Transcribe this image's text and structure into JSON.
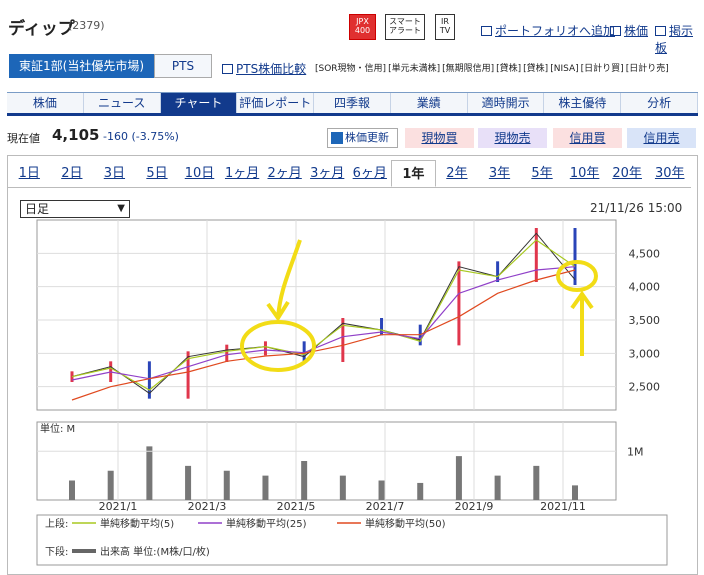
{
  "header": {
    "name": "ディップ",
    "code": "(2379)",
    "badges": {
      "jpx": "JPX 400",
      "alert": "スマート アラート",
      "ir": "IR TV"
    },
    "links": {
      "portfolio": "ポートフォリオへ追加",
      "stock_price": "株価",
      "board": "掲示板"
    }
  },
  "market_tabs": {
    "primary": "東証1部(当社優先市場)",
    "secondary": "PTS",
    "compare_link": "PTS株価比較"
  },
  "tags": [
    "[SOR現物・信用]",
    "[単元未満株]",
    "[無期限信用]",
    "[貸株]",
    "[貸株]",
    "[NISA]",
    "[日計り買]",
    "[日計り売]"
  ],
  "nav": [
    "株価",
    "ニュース",
    "チャート",
    "評価レポート",
    "四季報",
    "業績",
    "適時開示",
    "株主優待",
    "分析"
  ],
  "nav_active": "チャート",
  "price": {
    "label": "現在値",
    "value": "4,105",
    "change": "-160 (-3.75%)"
  },
  "buttons": {
    "refresh": "株価更新",
    "cash_buy": "現物買",
    "cash_sell": "現物売",
    "margin_buy": "信用買",
    "margin_sell": "信用売"
  },
  "colors": {
    "cash_buy": "#fbe0e0",
    "cash_sell": "#e8e0f8",
    "margin_buy": "#fbe0e0",
    "margin_sell": "#d9e4f8",
    "nav_active": "#123a8c",
    "up_candle": "#e0364c",
    "down_candle": "#2a44b8",
    "ma5": "#a8c820",
    "ma25": "#9040c8",
    "ma50": "#e04a20",
    "annotation": "#f2dc16"
  },
  "periods": [
    "1日",
    "2日",
    "3日",
    "5日",
    "10日",
    "1ヶ月",
    "2ヶ月",
    "3ヶ月",
    "6ヶ月",
    "1年",
    "2年",
    "3年",
    "5年",
    "10年",
    "20年",
    "30年"
  ],
  "period_active": "1年",
  "interval": "日足",
  "datetime": "21/11/26 15:00",
  "volume_unit": "単位: M",
  "legend": {
    "upper_label": "上段:",
    "lower_label": "下段:",
    "ma5": "単純移動平均(5)",
    "ma25": "単純移動平均(25)",
    "ma50": "単純移動平均(50)",
    "volume": "出来高 単位:(M株/口/枚)"
  },
  "chart_data": {
    "type": "line",
    "title": "",
    "xlabel": "",
    "ylabel": "",
    "x_ticks": [
      "2021/1",
      "2021/3",
      "2021/5",
      "2021/7",
      "2021/9",
      "2021/11"
    ],
    "y_ticks": [
      2500,
      3000,
      3500,
      4000,
      4500
    ],
    "ylim": [
      2150,
      5000
    ],
    "volume_ticks": [
      "1M"
    ],
    "volume_ylim": [
      0,
      1.6
    ],
    "grid": true,
    "series": [
      {
        "name": "",
        "x": [
          "2020/11",
          "2020/12",
          "2021/1",
          "2021/2",
          "2021/3",
          "2021/4",
          "2021/5",
          "2021/6",
          "2021/7",
          "2021/8",
          "2021/9",
          "2021/10",
          "2021/11",
          "2021/11/26"
        ],
        "values": [
          2650,
          2800,
          2400,
          2950,
          3050,
          3100,
          2950,
          3450,
          3350,
          3200,
          4300,
          4150,
          4800,
          4105
        ]
      },
      {
        "name": "単純移動平均(5)",
        "x": [
          "2020/11",
          "2020/12",
          "2021/1",
          "2021/2",
          "2021/3",
          "2021/4",
          "2021/5",
          "2021/6",
          "2021/7",
          "2021/8",
          "2021/9",
          "2021/10",
          "2021/11",
          "2021/11/26"
        ],
        "values": [
          2650,
          2780,
          2450,
          2920,
          3030,
          3100,
          2980,
          3420,
          3350,
          3180,
          4250,
          4150,
          4700,
          4300
        ]
      },
      {
        "name": "単純移動平均(25)",
        "x": [
          "2020/11",
          "2020/12",
          "2021/1",
          "2021/2",
          "2021/3",
          "2021/4",
          "2021/5",
          "2021/6",
          "2021/7",
          "2021/8",
          "2021/9",
          "2021/10",
          "2021/11",
          "2021/11/26"
        ],
        "values": [
          2600,
          2720,
          2620,
          2800,
          2980,
          3050,
          3010,
          3250,
          3320,
          3220,
          3900,
          4100,
          4250,
          4300
        ]
      },
      {
        "name": "単純移動平均(50)",
        "x": [
          "2020/11",
          "2020/12",
          "2021/1",
          "2021/2",
          "2021/3",
          "2021/4",
          "2021/5",
          "2021/6",
          "2021/7",
          "2021/8",
          "2021/9",
          "2021/10",
          "2021/11",
          "2021/11/26"
        ],
        "values": [
          2300,
          2500,
          2620,
          2720,
          2880,
          2960,
          3000,
          3120,
          3280,
          3280,
          3550,
          3900,
          4100,
          4250
        ]
      }
    ],
    "volume": [
      0.4,
      0.6,
      1.1,
      0.7,
      0.6,
      0.5,
      0.8,
      0.5,
      0.4,
      0.35,
      0.9,
      0.5,
      0.7,
      0.3
    ]
  }
}
